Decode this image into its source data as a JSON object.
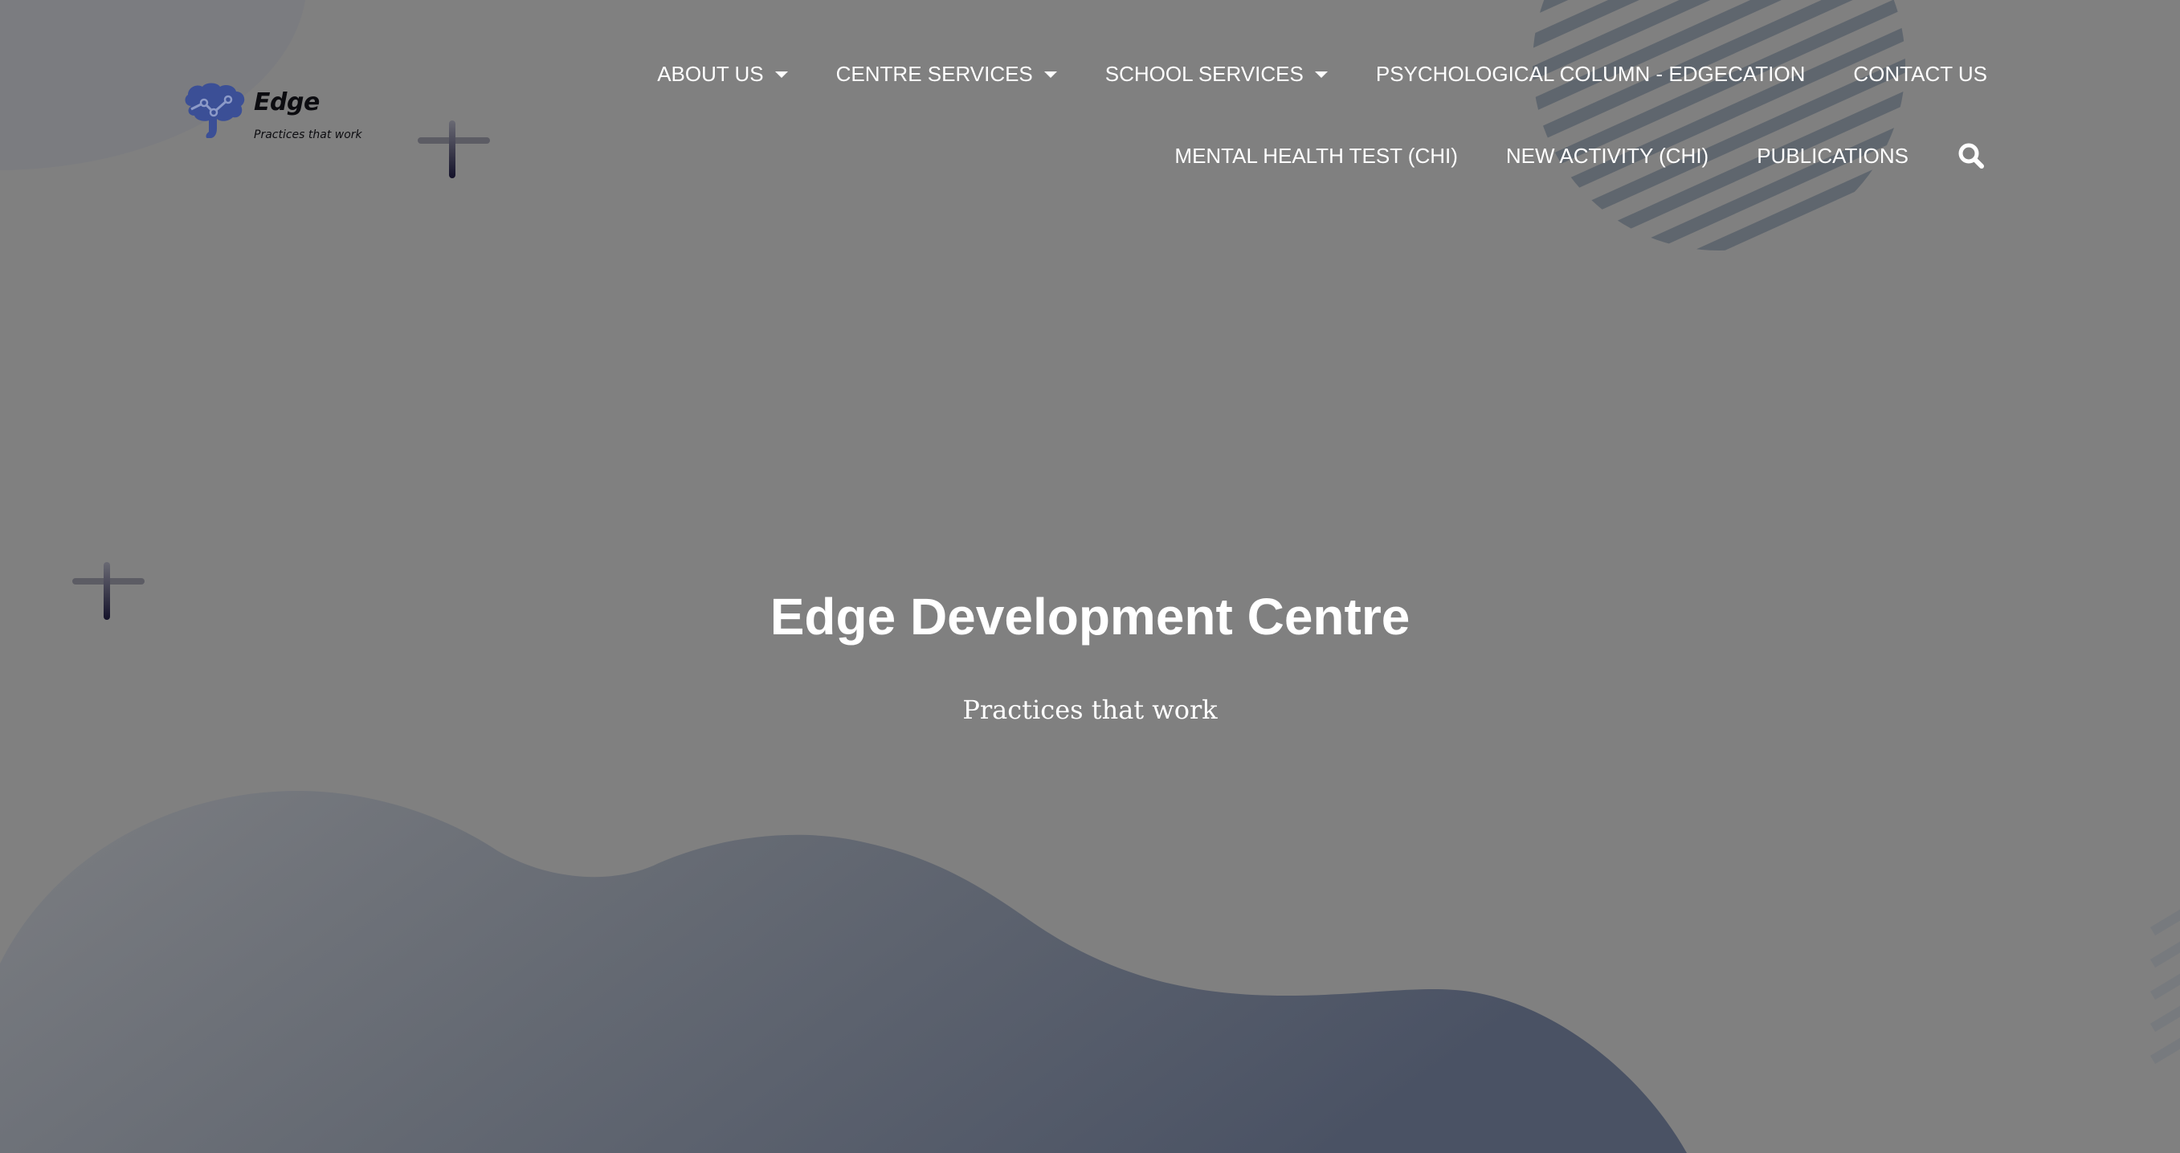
{
  "logo": {
    "name": "Edge",
    "tagline": "Practices that work",
    "brand_color": "#3b4f96"
  },
  "nav": {
    "row1": [
      {
        "label": "ABOUT US",
        "has_dropdown": true
      },
      {
        "label": "CENTRE SERVICES",
        "has_dropdown": true
      },
      {
        "label": "SCHOOL SERVICES",
        "has_dropdown": true
      },
      {
        "label": "PSYCHOLOGICAL COLUMN - EDGECATION",
        "has_dropdown": false
      },
      {
        "label": "CONTACT US",
        "has_dropdown": false
      }
    ],
    "row2": [
      {
        "label": "MENTAL HEALTH TEST (CHI)",
        "has_dropdown": false
      },
      {
        "label": "NEW ACTIVITY (CHI)",
        "has_dropdown": false
      },
      {
        "label": "PUBLICATIONS",
        "has_dropdown": false
      }
    ],
    "search_icon": "search-icon"
  },
  "hero": {
    "title": "Edge Development Centre",
    "subtitle": "Practices that work"
  },
  "colors": {
    "overlay": "#808080",
    "wave_dark": "#4a5364",
    "text": "#ffffff"
  }
}
